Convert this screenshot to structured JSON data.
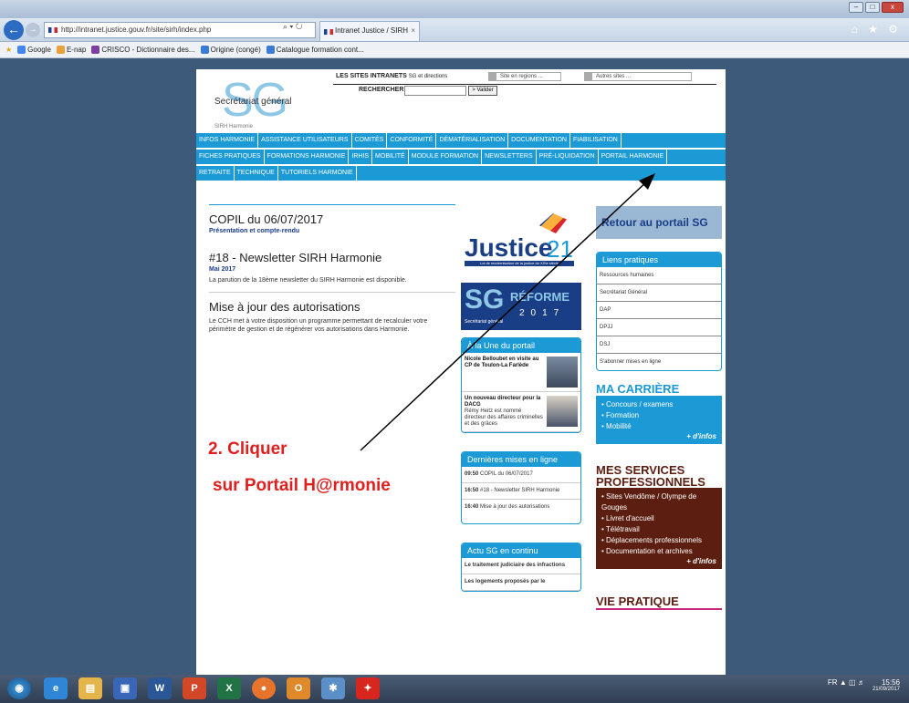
{
  "browser": {
    "url": "http://intranet.justice.gouv.fr/site/sirh/index.php",
    "addr_actions": "⌕ ▾ ↻",
    "tab_title": "Intranet Justice / SIRH Har...",
    "tab_close": "×",
    "nav_right": "⌂ ★ ⚙",
    "win_min": "–",
    "win_max": "□",
    "win_close": "x",
    "favorites": [
      {
        "label": "Google",
        "color": "#4285f4"
      },
      {
        "label": "E-nap",
        "color": "#e9a23b"
      },
      {
        "label": "CRISCO - Dictionnaire des...",
        "color": "#7b3fa0"
      },
      {
        "label": "Origine (congé)",
        "color": "#3a7bd5"
      },
      {
        "label": "Catalogue formation cont...",
        "color": "#3a7bd5"
      }
    ]
  },
  "header": {
    "logo_letters": "SG",
    "logo_title": "Secrétariat général",
    "logo_sub": "SIRH Harmonie",
    "sites_label": "LES SITES INTRANETS",
    "select1": "SG et directions",
    "select2": "Site en regions ...",
    "select3": "Autres sites ...",
    "search_label": "RECHERCHER",
    "search_btn": "> Valider"
  },
  "menu": {
    "row1": [
      "INFOS HARMONIE",
      "ASSISTANCE UTILISATEURS",
      "COMITÉS",
      "CONFORMITÉ",
      "DÉMATÉRIALISATION",
      "DOCUMENTATION",
      "FIABILISATION"
    ],
    "row2": [
      "FICHES PRATIQUES",
      "FORMATIONS HARMONIE",
      "IRHIS",
      "MOBILITÉ",
      "MODULE FORMATION",
      "NEWSLETTERS",
      "PRÉ-LIQUIDATION",
      "PORTAIL HARMONIE"
    ],
    "row3": [
      "RETRAITE",
      "TECHNIQUE",
      "TUTORIELS HARMONIE"
    ]
  },
  "news": [
    {
      "title": "COPIL du 06/07/2017",
      "sub": "Présentation et compte-rendu",
      "date": "",
      "text": ""
    },
    {
      "title": "#18 - Newsletter SIRH Harmonie",
      "sub": "",
      "date": "Mai 2017",
      "text": "La parution de la 18ème newsletter du SIRH Harmonie est disponible."
    },
    {
      "title": "Mise à jour des autorisations",
      "sub": "",
      "date": "",
      "text": "Le CCH met à votre disposition un programme permettant de recalculer votre périmètre de gestion et de régénérer vos autorisations dans Harmonie."
    }
  ],
  "promo": {
    "justice_word": "Justice",
    "justice_num": "21",
    "justice_tag": "Loi de modernisation de la justice du XXIe siècle",
    "reforme_sg": "SG",
    "reforme_word": "RÉFORME",
    "reforme_year": "2017",
    "reforme_sub": "Secrétariat général"
  },
  "une": {
    "title": "À la Une du portail",
    "items": [
      {
        "bold": "Nicole Belloubet en visite au CP de Toulon-La Farlède",
        "text": ""
      },
      {
        "bold": "Un nouveau directeur pour la DACG",
        "text": "Rémy Heitz est nommé directeur des affaires criminelles et des grâces"
      }
    ]
  },
  "dernieres": {
    "title": "Dernières mises en ligne",
    "items": [
      {
        "time": "09:50",
        "text": "COPIL du 06/07/2017"
      },
      {
        "time": "16:50",
        "text": "#18 - Newsletter SIRH Harmonie"
      },
      {
        "time": "16:40",
        "text": "Mise à jour des autorisations"
      }
    ]
  },
  "actu": {
    "title": "Actu SG en continu",
    "items": [
      "Le traitement judiciaire des infractions",
      "Les logements proposés par le"
    ]
  },
  "right": {
    "retour": "Retour au portail SG",
    "liens_title": "Liens pratiques",
    "liens": [
      "Ressources humaines",
      "Secrétariat Général",
      "DAP",
      "DPJJ",
      "DSJ",
      "S'abonner mises en ligne"
    ],
    "carriere_title": "MA CARRIÈRE",
    "carriere": [
      "Concours / examens",
      "Formation",
      "Mobilité"
    ],
    "more": "+ d'infos",
    "services_title": "MES SERVICES PROFESSIONNELS",
    "services": [
      "Sites Vendôme / Olympe de Gouges",
      "Livret d'accueil",
      "Télétravail",
      "Déplacements professionnels",
      "Documentation et archives"
    ],
    "vie_title": "VIE PRATIQUE"
  },
  "instruction": {
    "line1": "2.   Cliquer",
    "line2": "sur Portail H@rmonie",
    "color": "#e0201f"
  },
  "taskbar": {
    "start": "◉",
    "icons": [
      "e",
      "▤",
      "▣",
      "W",
      "P",
      "X",
      "●",
      "O",
      "✱",
      "✦"
    ],
    "lang": "FR",
    "time": "15:56",
    "date": "21/09/2017"
  }
}
